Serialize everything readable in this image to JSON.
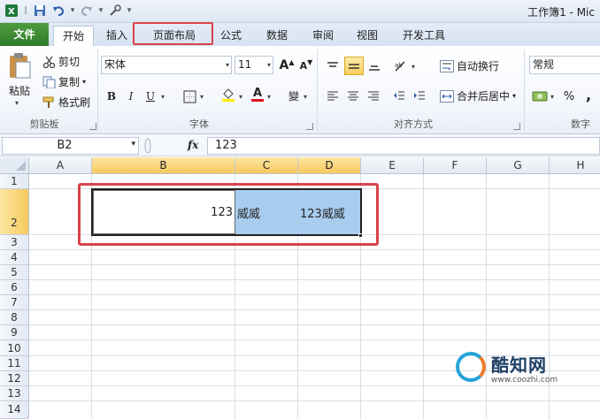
{
  "window": {
    "title": "工作簿1 - Mic"
  },
  "tabs": [
    {
      "label": "文件"
    },
    {
      "label": "开始"
    },
    {
      "label": "插入"
    },
    {
      "label": "页面布局"
    },
    {
      "label": "公式"
    },
    {
      "label": "数据"
    },
    {
      "label": "审阅"
    },
    {
      "label": "视图"
    },
    {
      "label": "开发工具"
    }
  ],
  "clipboard": {
    "paste": "粘贴",
    "cut": "剪切",
    "copy": "复制",
    "format_painter": "格式刷",
    "group": "剪贴板"
  },
  "font": {
    "name": "宋体",
    "size": "11",
    "grow": "A",
    "shrink": "A",
    "bold": "B",
    "italic": "I",
    "underline": "U",
    "group": "字体"
  },
  "alignment": {
    "wrap": "自动换行",
    "merge": "合并后居中",
    "group": "对齐方式"
  },
  "number": {
    "format": "常规",
    "percent": "%",
    "comma": ",",
    "group": "数字"
  },
  "formula_bar": {
    "name_box": "B2",
    "fx": "fx",
    "value": "123"
  },
  "grid": {
    "columns": [
      "A",
      "B",
      "C",
      "D",
      "E",
      "F",
      "G",
      "H"
    ],
    "rows": [
      "1",
      "2",
      "3",
      "4",
      "5",
      "6",
      "7",
      "8",
      "9",
      "10",
      "11",
      "12",
      "13",
      "14"
    ],
    "cells": {
      "B2": "123",
      "C2": "威威",
      "D2": "123威威"
    }
  },
  "watermark": {
    "title": "酷知网",
    "url": "www.coozhi.com"
  },
  "colors": {
    "accent_red": "#d9434a",
    "file_tab": "#2f7d2a",
    "selected_fill": "#a8cdee",
    "header_selected": "#f7c95d"
  }
}
